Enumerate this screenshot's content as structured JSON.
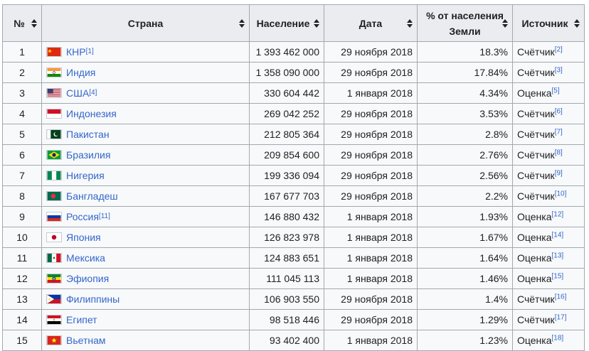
{
  "table": {
    "headers": {
      "rank": "№",
      "country": "Страна",
      "population": "Население",
      "date": "Дата",
      "percent": "% от населения Земли",
      "source": "Источник"
    },
    "rows": [
      {
        "rank": "1",
        "flag": "china-flag-icon",
        "country": "КНР",
        "country_ref": "[1]",
        "population": "1 393 462 000",
        "date": "29 ноября 2018",
        "percent": "18.3%",
        "source": "Счётчик",
        "source_ref": "[2]"
      },
      {
        "rank": "2",
        "flag": "india-flag-icon",
        "country": "Индия",
        "country_ref": "",
        "population": "1 358 090 000",
        "date": "29 ноября 2018",
        "percent": "17.84%",
        "source": "Счётчик",
        "source_ref": "[3]"
      },
      {
        "rank": "3",
        "flag": "usa-flag-icon",
        "country": "США",
        "country_ref": "[4]",
        "population": "330 604 442",
        "date": "1 января 2018",
        "percent": "4.34%",
        "source": "Оценка",
        "source_ref": "[5]"
      },
      {
        "rank": "4",
        "flag": "indonesia-flag-icon",
        "country": "Индонезия",
        "country_ref": "",
        "population": "269 042 252",
        "date": "29 ноября 2018",
        "percent": "3.53%",
        "source": "Счётчик",
        "source_ref": "[6]"
      },
      {
        "rank": "5",
        "flag": "pakistan-flag-icon",
        "country": "Пакистан",
        "country_ref": "",
        "population": "212 805 364",
        "date": "29 ноября 2018",
        "percent": "2.8%",
        "source": "Счётчик",
        "source_ref": "[7]"
      },
      {
        "rank": "6",
        "flag": "brazil-flag-icon",
        "country": "Бразилия",
        "country_ref": "",
        "population": "209 854 600",
        "date": "29 ноября 2018",
        "percent": "2.76%",
        "source": "Счётчик",
        "source_ref": "[8]"
      },
      {
        "rank": "7",
        "flag": "nigeria-flag-icon",
        "country": "Нигерия",
        "country_ref": "",
        "population": "199 336 094",
        "date": "29 ноября 2018",
        "percent": "2.56%",
        "source": "Счётчик",
        "source_ref": "[9]"
      },
      {
        "rank": "8",
        "flag": "bangladesh-flag-icon",
        "country": "Бангладеш",
        "country_ref": "",
        "population": "167 677 703",
        "date": "29 ноября 2018",
        "percent": "2.2%",
        "source": "Счётчик",
        "source_ref": "[10]"
      },
      {
        "rank": "9",
        "flag": "russia-flag-icon",
        "country": "Россия",
        "country_ref": "[11]",
        "population": "146 880 432",
        "date": "1 января 2018",
        "percent": "1.93%",
        "source": "Оценка",
        "source_ref": "[12]"
      },
      {
        "rank": "10",
        "flag": "japan-flag-icon",
        "country": "Япония",
        "country_ref": "",
        "population": "126 823 978",
        "date": "1 января 2018",
        "percent": "1.67%",
        "source": "Оценка",
        "source_ref": "[14]"
      },
      {
        "rank": "11",
        "flag": "mexico-flag-icon",
        "country": "Мексика",
        "country_ref": "",
        "population": "124 883 651",
        "date": "1 января 2018",
        "percent": "1.64%",
        "source": "Оценка",
        "source_ref": "[13]"
      },
      {
        "rank": "12",
        "flag": "ethiopia-flag-icon",
        "country": "Эфиопия",
        "country_ref": "",
        "population": "111 045 113",
        "date": "1 января 2018",
        "percent": "1.46%",
        "source": "Оценка",
        "source_ref": "[15]"
      },
      {
        "rank": "13",
        "flag": "philippines-flag-icon",
        "country": "Филиппины",
        "country_ref": "",
        "population": "106 903 550",
        "date": "29 ноября 2018",
        "percent": "1.4%",
        "source": "Счётчик",
        "source_ref": "[16]"
      },
      {
        "rank": "14",
        "flag": "egypt-flag-icon",
        "country": "Египет",
        "country_ref": "",
        "population": "98 518 446",
        "date": "29 ноября 2018",
        "percent": "1.29%",
        "source": "Счётчик",
        "source_ref": "[17]"
      },
      {
        "rank": "15",
        "flag": "vietnam-flag-icon",
        "country": "Вьетнам",
        "country_ref": "",
        "population": "93 402 400",
        "date": "1 января 2018",
        "percent": "1.23%",
        "source": "Оценка",
        "source_ref": "[18]"
      }
    ]
  },
  "colors": {
    "link": "#3366cc",
    "header_bg": "#eaecf0",
    "cell_bg": "#f8f9fa",
    "border": "#a2a9b1"
  }
}
